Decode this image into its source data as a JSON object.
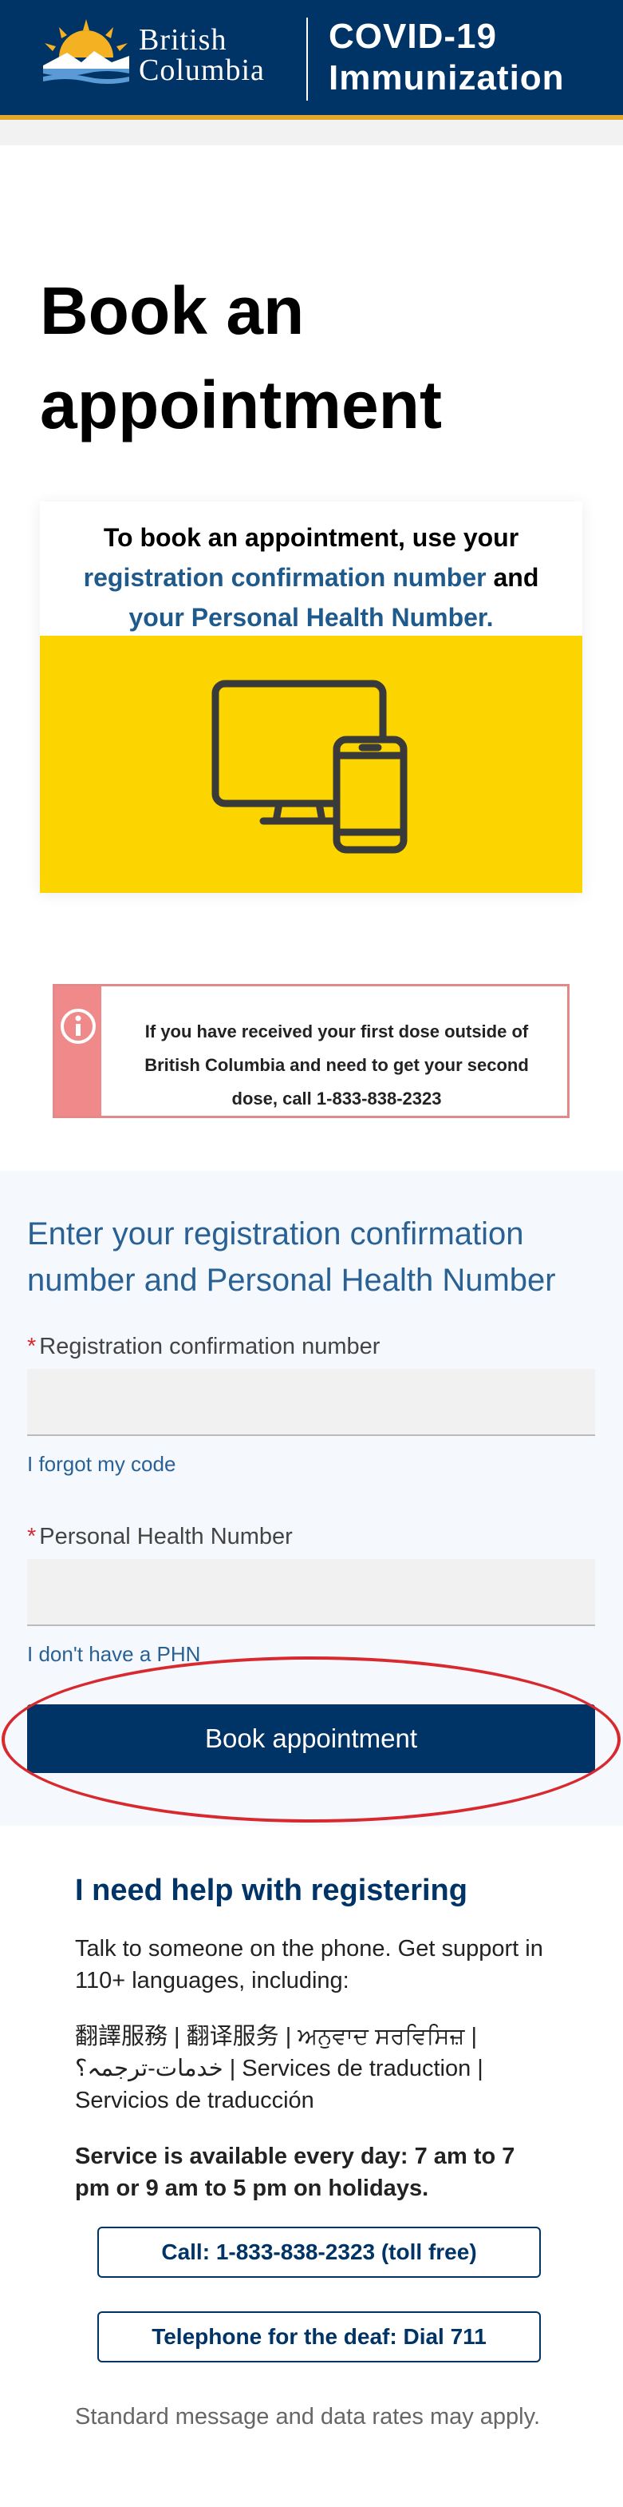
{
  "header": {
    "logo_line1": "British",
    "logo_line2": "Columbia",
    "title_line1": "COVID-19",
    "title_line2": "Immunization"
  },
  "page": {
    "title_line1": "Book an",
    "title_line2": "appointment"
  },
  "info_card": {
    "text_pre": "To book an appointment, use your",
    "link1": "registration confirmation number",
    "text_mid": "and",
    "link2": "your Personal Health Number."
  },
  "alert": {
    "text": "If you have received your first dose outside of British Columbia and need to get your second dose, call 1-833-838-2323"
  },
  "form": {
    "heading": "Enter your registration confirmation number and Personal Health Number",
    "required_mark": "*",
    "reg_label": "Registration confirmation number",
    "reg_value": "",
    "forgot_link": "I forgot my code",
    "phn_label": "Personal Health Number",
    "phn_value": "",
    "no_phn_link": "I don't have a PHN",
    "submit_label": "Book appointment"
  },
  "help": {
    "title": "I need help with registering",
    "intro": "Talk to someone on the phone. Get support in 110+ languages, including:",
    "languages": "翻譯服務 | 翻译服务 | ਅਨੁਵਾਦ ਸਰਵਿਸਿਜ਼ | خدمات-ترجمہ؟ | Services de traduction | Servicios de traducción",
    "hours": "Service is available every day: 7 am to 7 pm or 9 am to 5 pm on holidays.",
    "call_button": "Call: 1-833-838-2323 (toll free)",
    "tty_button": "Telephone for the deaf: Dial 711",
    "note": "Standard message and data rates may apply."
  },
  "colors": {
    "brand_navy": "#003366",
    "brand_gold": "#e3a82b",
    "link_blue": "#2a6195",
    "alert_red": "#f08a8a",
    "card_yellow": "#fcd500",
    "required_red": "#d8292f"
  },
  "icons": [
    "bc-sun-logo",
    "info-icon",
    "devices-icon"
  ]
}
